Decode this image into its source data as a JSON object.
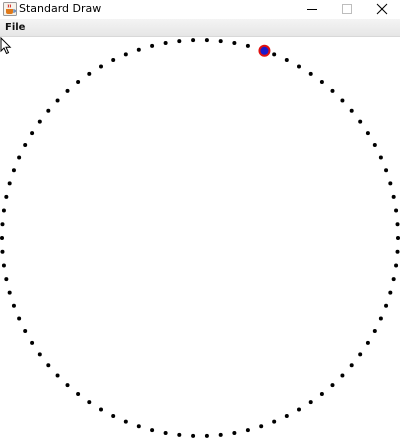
{
  "window": {
    "title": "Standard Draw",
    "icon": "java-coffee-cup-icon"
  },
  "menubar": {
    "items": [
      {
        "label": "File"
      }
    ]
  },
  "canvas": {
    "drawing": "dotted-circle",
    "dot_color": "#000000",
    "ball": {
      "fill_color": "#1a1acc",
      "ring_color": "#e01010"
    }
  },
  "colors": {
    "background": "#ffffff",
    "menubar": "#ececec"
  }
}
